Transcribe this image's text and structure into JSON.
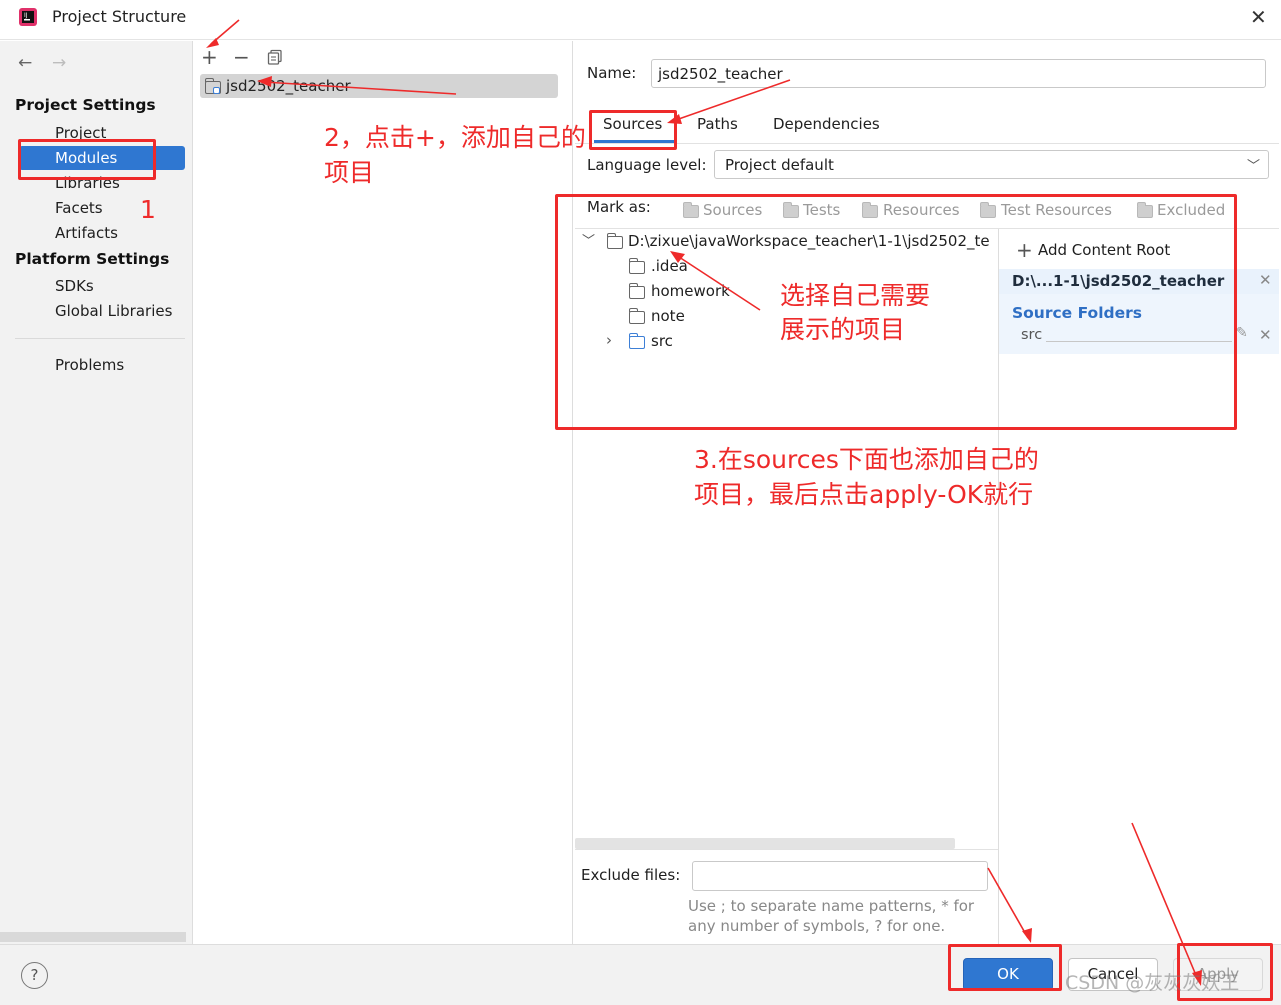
{
  "window": {
    "title": "Project Structure"
  },
  "sidebar": {
    "project_settings_header": "Project Settings",
    "project_settings_items": [
      "Project",
      "Modules",
      "Libraries",
      "Facets",
      "Artifacts"
    ],
    "platform_settings_header": "Platform Settings",
    "platform_settings_items": [
      "SDKs",
      "Global Libraries"
    ],
    "problems": "Problems",
    "selected": "Modules"
  },
  "modules": {
    "items": [
      "jsd2502_teacher"
    ]
  },
  "module_detail": {
    "name_label": "Name:",
    "name_value": "jsd2502_teacher",
    "tabs": [
      "Sources",
      "Paths",
      "Dependencies"
    ],
    "active_tab": "Sources",
    "language_level_label": "Language level:",
    "language_level_value": "Project default",
    "mark_as_label": "Mark as:",
    "mark_as_options": [
      "Sources",
      "Tests",
      "Resources",
      "Test Resources",
      "Excluded"
    ],
    "tree": {
      "root": "D:\\zixue\\javaWorkspace_teacher\\1-1\\jsd2502_te",
      "children": [
        ".idea",
        "homework",
        "note",
        "src"
      ]
    },
    "content_root": {
      "add_label": "Add Content Root",
      "path": "D:\\...1-1\\jsd2502_teacher",
      "source_folders_header": "Source Folders",
      "source_folders": [
        "src"
      ]
    },
    "exclude_files_label": "Exclude files:",
    "exclude_files_value": "",
    "exclude_hint_line1": "Use ; to separate name patterns, * for",
    "exclude_hint_line2": "any number of symbols, ? for one."
  },
  "buttons": {
    "help": "?",
    "ok": "OK",
    "cancel": "Cancel",
    "apply": "Apply"
  },
  "annotations": {
    "step1": "1",
    "step2_line1": "2，点击+，添加自己的",
    "step2_line2": "项目",
    "choose_line1": "选择自己需要",
    "choose_line2": "展示的项目",
    "step3_line1": "3.在sources下面也添加自己的",
    "step3_line2": "项目，最后点击apply-OK就行"
  },
  "watermark": "CSDN @灰灰灰妖王",
  "colors": {
    "accent": "#2f77d1",
    "annotation_red": "#ee2a2a",
    "selection_bg": "#2f77d1"
  }
}
